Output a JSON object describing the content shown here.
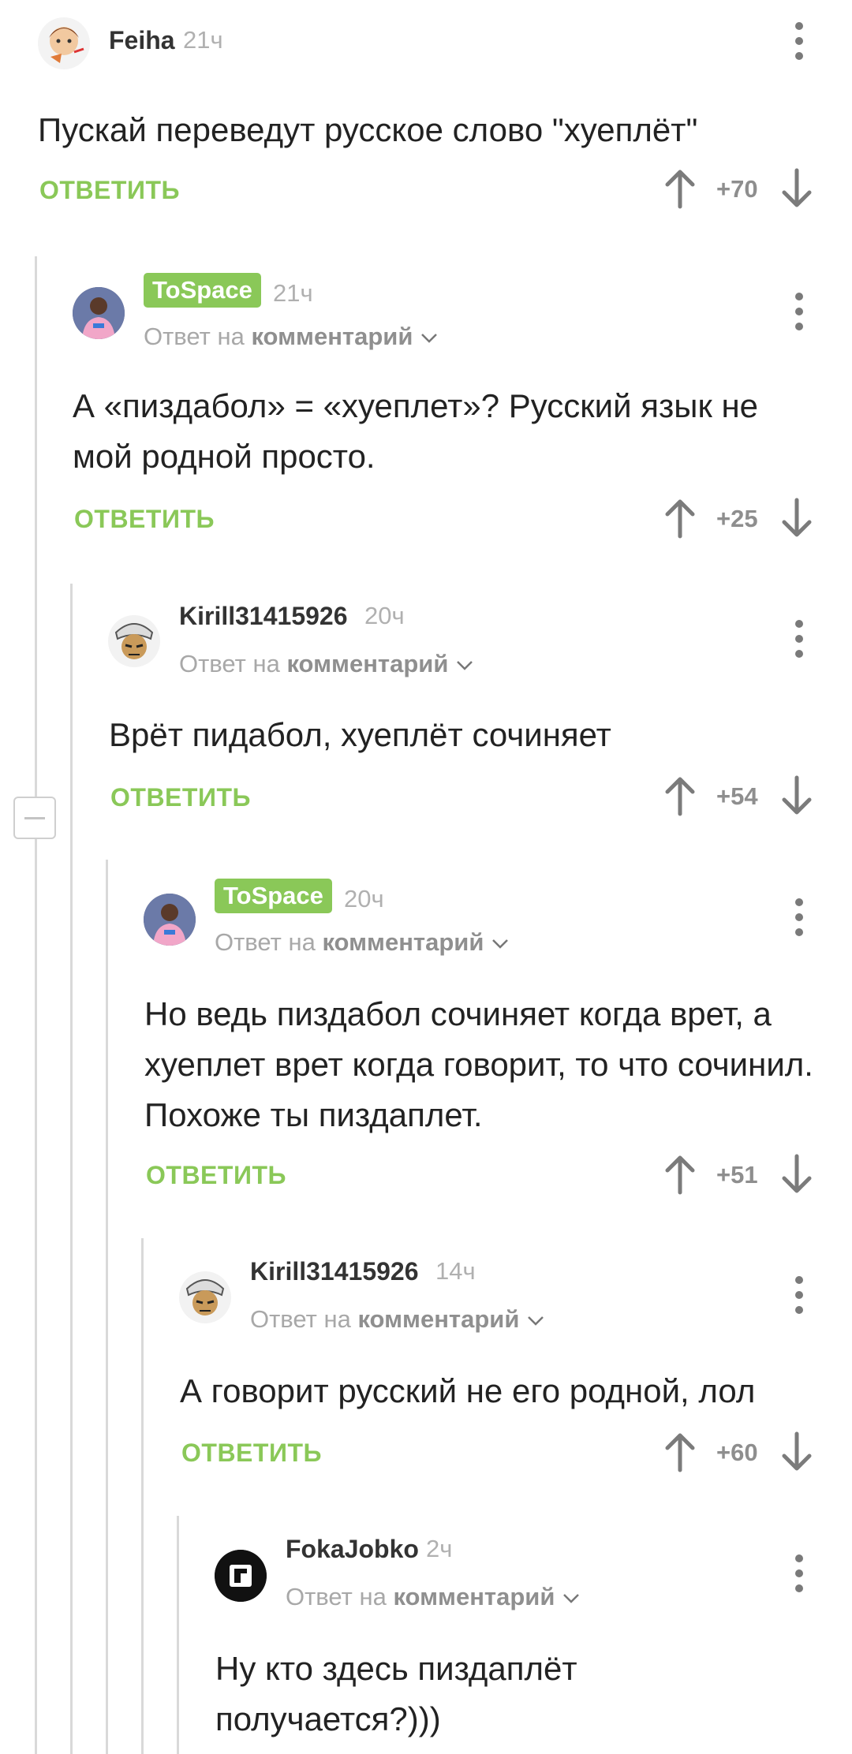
{
  "comments": [
    {
      "username": "Feiha",
      "time": "21ч",
      "text": "Пускай переведут русское слово \"хуеплёт\"",
      "reply_label": "ОТВЕТИТЬ",
      "score": "+70"
    },
    {
      "username": "ToSpace",
      "time": "21ч",
      "reply_prefix": "Ответ на",
      "reply_target": "комментарий",
      "text": "А «пиздабол» = «хуеплет»? Русский язык не мой родной просто.",
      "reply_label": "ОТВЕТИТЬ",
      "score": "+25"
    },
    {
      "username": "Kirill31415926",
      "time": "20ч",
      "reply_prefix": "Ответ на",
      "reply_target": "комментарий",
      "text": "Врёт пидабол, хуеплёт сочиняет",
      "reply_label": "ОТВЕТИТЬ",
      "score": "+54"
    },
    {
      "username": "ToSpace",
      "time": "20ч",
      "reply_prefix": "Ответ на",
      "reply_target": "комментарий",
      "text": "Но ведь пиздабол сочиняет когда врет, а хуеплет врет когда говорит, то что сочинил. Похоже ты пиздаплет.",
      "reply_label": "ОТВЕТИТЬ",
      "score": "+51"
    },
    {
      "username": "Kirill31415926",
      "time": "14ч",
      "reply_prefix": "Ответ на",
      "reply_target": "комментарий",
      "text": "А говорит русский не его родной, лол",
      "reply_label": "ОТВЕТИТЬ",
      "score": "+60"
    },
    {
      "username": "FokaJobko",
      "time": "2ч",
      "reply_prefix": "Ответ на",
      "reply_target": "комментарий",
      "text": "Ну кто здесь пиздаплёт получается?)))"
    }
  ],
  "colors": {
    "accent": "#8ac858",
    "muted": "#a8a8a8",
    "text": "#222222"
  },
  "icons": [
    "more-vertical-icon",
    "arrow-up-icon",
    "arrow-down-icon",
    "chevron-down-icon",
    "collapse-thread-icon"
  ]
}
